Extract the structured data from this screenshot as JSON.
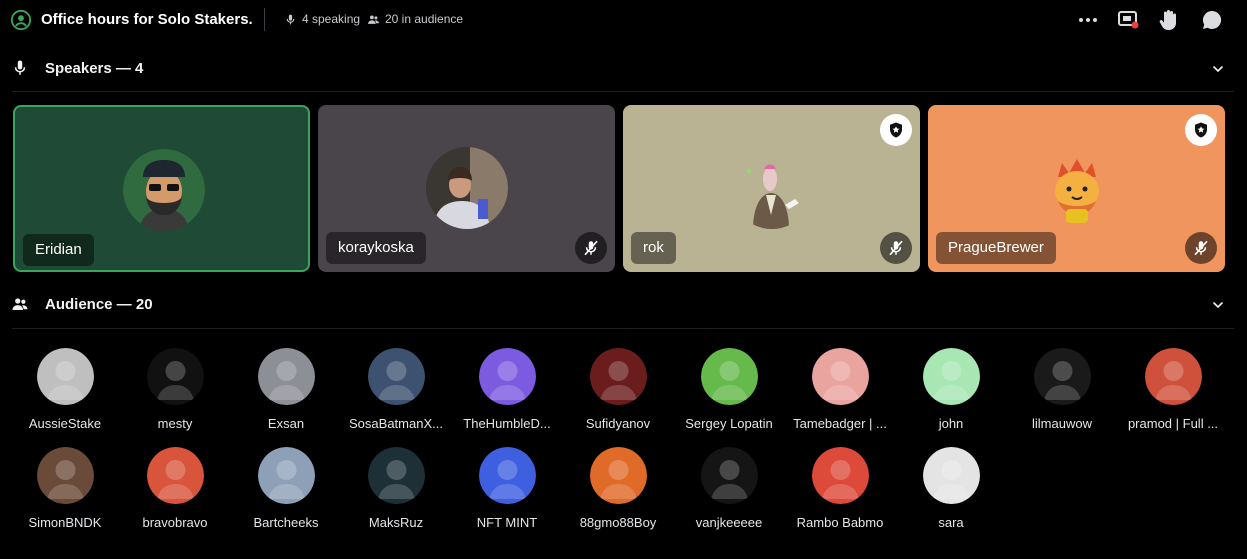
{
  "header": {
    "title": "Office hours for Solo Stakers.",
    "speaking": "4 speaking",
    "audience": "20 in audience",
    "icons": [
      "stage-icon",
      "more-icon",
      "screen-share-icon",
      "raise-hand-icon",
      "chat-icon"
    ]
  },
  "speakers_section": {
    "label": "Speakers — 4"
  },
  "speakers": [
    {
      "name": "Eridian",
      "bg": "#1f4a35",
      "border": "#3ba55d",
      "muted": false,
      "mod": false
    },
    {
      "name": "koraykoska",
      "bg": "#4a454b",
      "muted": true,
      "mod": false
    },
    {
      "name": "rok",
      "bg": "#b9b394",
      "muted": true,
      "mod": true
    },
    {
      "name": "PragueBrewer",
      "bg": "#f1955f",
      "muted": true,
      "mod": true
    }
  ],
  "audience_section": {
    "label": "Audience — 20"
  },
  "audience": [
    {
      "name": "AussieStake",
      "color": "#bfbfbf"
    },
    {
      "name": "mesty",
      "color": "#111111"
    },
    {
      "name": "Exsan",
      "color": "#8d8f96"
    },
    {
      "name": "SosaBatmanX...",
      "color": "#3c5270"
    },
    {
      "name": "TheHumbleD...",
      "color": "#7d5be0"
    },
    {
      "name": "Sufidyanov",
      "color": "#6b1d1d"
    },
    {
      "name": "Sergey Lopatin",
      "color": "#66b94b"
    },
    {
      "name": "Tamebadger | ...",
      "color": "#e9a4a0"
    },
    {
      "name": "john",
      "color": "#a8e6b4"
    },
    {
      "name": "lilmauwow",
      "color": "#1a1a1a"
    },
    {
      "name": "pramod | Full ...",
      "color": "#d0513b"
    },
    {
      "name": "SimonBNDK",
      "color": "#6a4a38"
    },
    {
      "name": "bravobravo",
      "color": "#d8553c"
    },
    {
      "name": "Bartcheeks",
      "color": "#8ea0b8"
    },
    {
      "name": "MaksRuz",
      "color": "#1d3038"
    },
    {
      "name": "NFT MINT",
      "color": "#3d5fe0"
    },
    {
      "name": "88gmo88Boy",
      "color": "#e06a28"
    },
    {
      "name": "vanjkeeeee",
      "color": "#151515"
    },
    {
      "name": "Rambo Babmo",
      "color": "#dd4a3a"
    },
    {
      "name": "sara",
      "color": "#e4e4e4"
    }
  ]
}
